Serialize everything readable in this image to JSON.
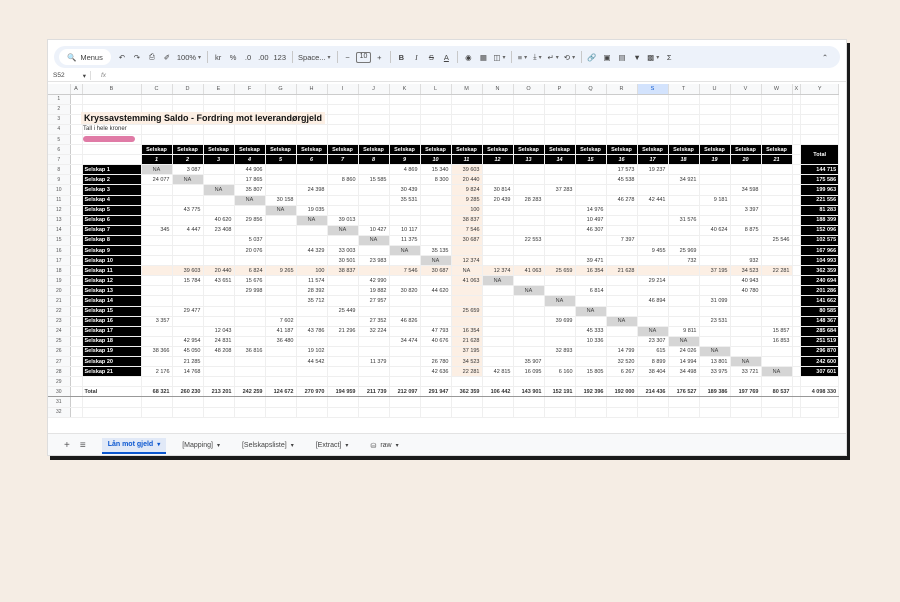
{
  "toolbar": {
    "menus_label": "Menus",
    "zoom": "100%",
    "currency": "kr",
    "percent": "%",
    "dec_less": ".0",
    "dec_more": ".00",
    "number_format": "123",
    "font": "Space...",
    "font_size": "10",
    "bold": "B",
    "italic": "I",
    "strike": "S",
    "text_color": "A"
  },
  "formula_bar": {
    "cell_ref": "S52",
    "fx": "fx"
  },
  "columns": [
    "A",
    "B",
    "C",
    "D",
    "E",
    "F",
    "G",
    "H",
    "I",
    "J",
    "K",
    "L",
    "M",
    "N",
    "O",
    "P",
    "Q",
    "R",
    "S",
    "T",
    "U",
    "V",
    "W",
    "X",
    "Y"
  ],
  "selected_column": "S",
  "title": "Kryssavstemming Saldo - Fordring mot leverandørgjeld",
  "subtitle": "Tall i hele kroner",
  "header": {
    "label": "Selskap",
    "numbers": [
      "1",
      "2",
      "3",
      "4",
      "5",
      "6",
      "7",
      "8",
      "9",
      "10",
      "11",
      "12",
      "13",
      "14",
      "15",
      "16",
      "17",
      "18",
      "19",
      "20",
      "21"
    ],
    "total": "Total"
  },
  "rows": [
    {
      "rn": "8",
      "name": "Selskap 1",
      "cells": [
        "NA",
        "3 087",
        "",
        "44 906",
        "",
        "",
        "",
        "",
        "4 869",
        "15 340",
        "39 603",
        "",
        "",
        "",
        "",
        "17 573",
        "19 237",
        "",
        "",
        "",
        "",
        "144 715"
      ]
    },
    {
      "rn": "9",
      "name": "Selskap 2",
      "cells": [
        "24 077",
        "NA",
        "",
        "17 865",
        "",
        "",
        "8 860",
        "15 585",
        "",
        "8 300",
        "20 440",
        "",
        "",
        "",
        "",
        "45 538",
        "",
        "34 921",
        "",
        "",
        "",
        "175 586"
      ]
    },
    {
      "rn": "10",
      "name": "Selskap 3",
      "cells": [
        "",
        "",
        "NA",
        "35 807",
        "",
        "24 398",
        "",
        "",
        "30 439",
        "",
        "9 824",
        "30 814",
        "",
        "37 283",
        "",
        "",
        "",
        "",
        "",
        "34 598",
        "",
        "199 963"
      ]
    },
    {
      "rn": "11",
      "name": "Selskap 4",
      "cells": [
        "",
        "",
        "",
        "NA",
        "30 158",
        "",
        "",
        "",
        "35 531",
        "",
        "9 285",
        "20 439",
        "28 283",
        "",
        "",
        "46 278",
        "42 441",
        "",
        "9 181",
        "",
        "",
        "221 556"
      ]
    },
    {
      "rn": "12",
      "name": "Selskap 5",
      "cells": [
        "",
        "43 775",
        "",
        "",
        "NA",
        "19 035",
        "",
        "",
        "",
        "",
        "100",
        "",
        "",
        "",
        "14 976",
        "",
        "",
        "",
        "",
        "3 397",
        "",
        "81 283"
      ]
    },
    {
      "rn": "13",
      "name": "Selskap 6",
      "cells": [
        "",
        "",
        "40 620",
        "29 856",
        "",
        "NA",
        "39 013",
        "",
        "",
        "",
        "38 837",
        "",
        "",
        "",
        "10 497",
        "",
        "",
        "31 576",
        "",
        "",
        "",
        "188 399"
      ]
    },
    {
      "rn": "14",
      "name": "Selskap 7",
      "cells": [
        "345",
        "4 447",
        "23 408",
        "",
        "",
        "",
        "NA",
        "10 427",
        "10 117",
        "",
        "7 546",
        "",
        "",
        "",
        "46 307",
        "",
        "",
        "",
        "40 624",
        "8 875",
        "",
        "152 096"
      ]
    },
    {
      "rn": "15",
      "name": "Selskap 8",
      "cells": [
        "",
        "",
        "",
        "5 037",
        "",
        "",
        "",
        "NA",
        "11 375",
        "",
        "30 687",
        "",
        "22 553",
        "",
        "",
        "7 397",
        "",
        "",
        "",
        "",
        "25 546",
        "102 575"
      ]
    },
    {
      "rn": "16",
      "name": "Selskap 9",
      "cells": [
        "",
        "",
        "",
        "20 076",
        "",
        "44 329",
        "33 003",
        "",
        "NA",
        "35 135",
        "",
        "",
        "",
        "",
        "",
        "",
        "9 455",
        "25 969",
        "",
        "",
        "",
        "167 966"
      ]
    },
    {
      "rn": "17",
      "name": "Selskap 10",
      "cells": [
        "",
        "",
        "",
        "",
        "",
        "",
        "30 501",
        "23 983",
        "",
        "NA",
        "12 374",
        "",
        "",
        "",
        "39 471",
        "",
        "",
        "732",
        "",
        "932",
        "",
        "104 993"
      ]
    },
    {
      "rn": "18",
      "name": "Selskap 11",
      "hl": true,
      "cells": [
        "",
        "39 603",
        "20 440",
        "6 824",
        "9 265",
        "100",
        "38 837",
        "",
        "7 546",
        "30 687",
        "NA",
        "12 374",
        "41 063",
        "25 659",
        "16 354",
        "21 628",
        "",
        "",
        "37 195",
        "34 523",
        "22 281",
        "362 359"
      ]
    },
    {
      "rn": "19",
      "name": "Selskap 12",
      "cells": [
        "",
        "15 784",
        "43 651",
        "15 676",
        "",
        "11 574",
        "",
        "42 990",
        "",
        "",
        "41 063",
        "NA",
        "",
        "",
        "",
        "",
        "29 214",
        "",
        "",
        "40 943",
        "",
        "240 694"
      ]
    },
    {
      "rn": "20",
      "name": "Selskap 13",
      "cells": [
        "",
        "",
        "",
        "29 998",
        "",
        "28 392",
        "",
        "19 882",
        "30 820",
        "44 620",
        "",
        "",
        "NA",
        "",
        "6 814",
        "",
        "",
        "",
        "",
        "40 780",
        "",
        "201 286"
      ]
    },
    {
      "rn": "21",
      "name": "Selskap 14",
      "cells": [
        "",
        "",
        "",
        "",
        "",
        "35 712",
        "",
        "27 957",
        "",
        "",
        "",
        "",
        "",
        "NA",
        "",
        "",
        "46 894",
        "",
        "31 099",
        "",
        "",
        "141 662"
      ]
    },
    {
      "rn": "22",
      "name": "Selskap 15",
      "cells": [
        "",
        "29 477",
        "",
        "",
        "",
        "",
        "25 449",
        "",
        "",
        "",
        "25 659",
        "",
        "",
        "",
        "NA",
        "",
        "",
        "",
        "",
        "",
        "",
        "80 585"
      ]
    },
    {
      "rn": "23",
      "name": "Selskap 16",
      "cells": [
        "3 357",
        "",
        "",
        "",
        "7 602",
        "",
        "",
        "27 352",
        "46 826",
        "",
        "",
        "",
        "",
        "39 699",
        "",
        "NA",
        "",
        "",
        "23 531",
        "",
        "",
        "148 367"
      ]
    },
    {
      "rn": "24",
      "name": "Selskap 17",
      "cells": [
        "",
        "",
        "12 043",
        "",
        "41 187",
        "43 786",
        "21 296",
        "32 224",
        "",
        "47 793",
        "16 354",
        "",
        "",
        "",
        "45 333",
        "",
        "NA",
        "9 811",
        "",
        "",
        "15 857",
        "285 684"
      ]
    },
    {
      "rn": "25",
      "name": "Selskap 18",
      "cells": [
        "",
        "42 954",
        "24 831",
        "",
        "36 480",
        "",
        "",
        "",
        "34 474",
        "40 676",
        "21 628",
        "",
        "",
        "",
        "10 336",
        "",
        "23 307",
        "NA",
        "",
        "",
        "16 853",
        "251 519"
      ]
    },
    {
      "rn": "26",
      "name": "Selskap 19",
      "cells": [
        "38 366",
        "45 050",
        "48 208",
        "36 816",
        "",
        "19 102",
        "",
        "",
        "",
        "",
        "37 195",
        "",
        "",
        "32 893",
        "",
        "14 799",
        "615",
        "24 026",
        "NA",
        "",
        "",
        "296 870"
      ]
    },
    {
      "rn": "27",
      "name": "Selskap 20",
      "cells": [
        "",
        "21 285",
        "",
        "",
        "",
        "44 542",
        "",
        "11 379",
        "",
        "26 780",
        "34 523",
        "",
        "35 907",
        "",
        "",
        "32 520",
        "8 899",
        "14 994",
        "13 801",
        "NA",
        "",
        "242 600"
      ]
    },
    {
      "rn": "28",
      "name": "Selskap 21",
      "cells": [
        "2 176",
        "14 768",
        "",
        "",
        "",
        "",
        "",
        "",
        "",
        "42 636",
        "22 281",
        "42 815",
        "16 095",
        "6 160",
        "15 805",
        "6 267",
        "38 404",
        "34 498",
        "33 975",
        "33 721",
        "NA",
        "307 601"
      ]
    }
  ],
  "empty_rows": [
    "29",
    "30",
    "31",
    "32"
  ],
  "total_row": {
    "rn": "30",
    "label": "Total",
    "cells": [
      "68 321",
      "260 230",
      "213 201",
      "242 259",
      "124 672",
      "270 970",
      "194 959",
      "211 739",
      "212 097",
      "291 947",
      "362 359",
      "106 442",
      "143 901",
      "152 191",
      "192 396",
      "192 000",
      "214 436",
      "176 527",
      "189 386",
      "197 769",
      "80 537",
      "4 098 330"
    ]
  },
  "sheet_tabs": [
    {
      "label": "Lån mot gjeld",
      "active": true
    },
    {
      "label": "[Mapping]"
    },
    {
      "label": "[Selskapsliste]"
    },
    {
      "label": "[Extract]"
    },
    {
      "label": "raw"
    }
  ],
  "colors": {
    "background": "#f5ede4",
    "highlight": "#fcefe4",
    "na_fill": "#d5d5d5",
    "header_black": "#000000",
    "accent": "#0b57d0",
    "redaction": "#e07ba6"
  }
}
